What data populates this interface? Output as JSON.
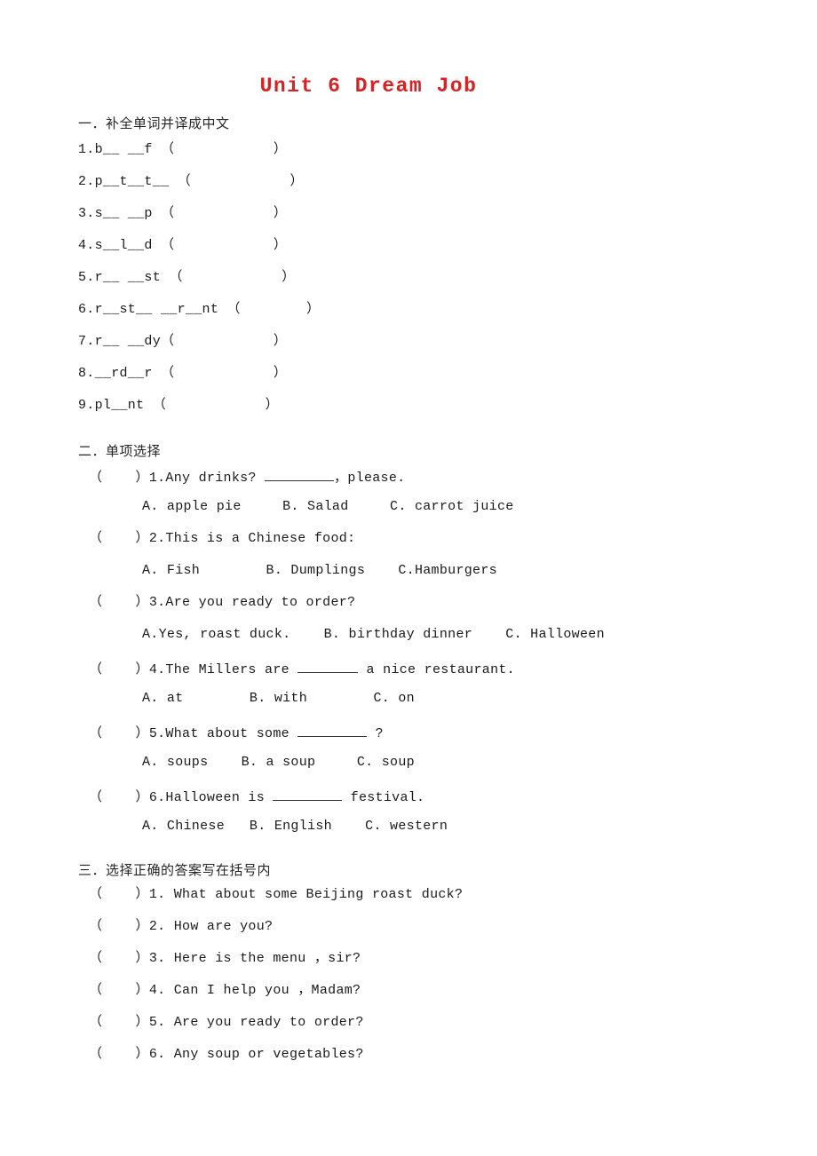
{
  "document": {
    "title": "Unit 6 Dream Job",
    "title_color": "#d62222"
  },
  "section1": {
    "heading": "一．补全单词并译成中文",
    "items": [
      {
        "number": "1.",
        "pre": "b",
        "blank1": "__",
        "mid": " ",
        "blank2": "__",
        "post": "f",
        "paren_open": "（",
        "paren_space": "            ",
        "paren_close": "）"
      },
      {
        "number": "2.",
        "text": "p__t__t__ （            ）"
      },
      {
        "number": "3.",
        "text": "s__ __p （            ）"
      },
      {
        "number": "4.",
        "text": "s__l__d （            ）"
      },
      {
        "number": "5.",
        "text": "r__ __st （            ）"
      },
      {
        "number": "6.",
        "text": "r__st__ __r__nt （        ）"
      },
      {
        "number": "7.",
        "text": "r__ __dy（            ）"
      },
      {
        "number": "8.",
        "text": "__rd__r （            ）"
      },
      {
        "number": "9.",
        "text": "pl__nt （            ）"
      }
    ],
    "raw_lines": [
      "1.b__ __f （            ）",
      "2.p__t__t__ （            ）",
      "3.s__ __p （            ）",
      "4.s__l__d （            ）",
      "5.r__ __st （            ）",
      "6.r__st__ __r__nt （        ）",
      "7.r__ __dy（            ）",
      "8.__rd__r （            ）",
      "9.pl__nt （            ）"
    ]
  },
  "section2": {
    "heading": "二．单项选择",
    "questions": [
      {
        "bracket": "（    ）",
        "number": "1.",
        "stem_before": "Any drinks? ",
        "stem_after": "，please.",
        "blank_size": "blank-lg",
        "options": "A. apple pie     B. Salad     C. carrot juice"
      },
      {
        "bracket": "（    ）",
        "number": "2.",
        "stem_before": "This is a Chinese food:",
        "stem_after": "",
        "blank_size": "none",
        "options": "A. Fish        B. Dumplings    C.Hamburgers"
      },
      {
        "bracket": "（    ）",
        "number": "3.",
        "stem_before": "Are you ready to order?",
        "stem_after": "",
        "blank_size": "none",
        "options": "A.Yes, roast duck.    B. birthday dinner    C. Halloween"
      },
      {
        "bracket": "（    ）",
        "number": "4.",
        "stem_before": "The Millers are ",
        "stem_after": " a nice restaurant.",
        "blank_size": "blank-md",
        "options": "A. at        B. with        C. on"
      },
      {
        "bracket": "（    ）",
        "number": "5.",
        "stem_before": "What about some ",
        "stem_after": " ?",
        "blank_size": "blank-lg",
        "options": "A. soups    B. a soup     C. soup"
      },
      {
        "bracket": "（    ）",
        "number": "6.",
        "stem_before": "Halloween is ",
        "stem_after": " festival.",
        "blank_size": "blank-lg",
        "options": "A. Chinese   B. English    C. western"
      }
    ]
  },
  "section3": {
    "heading": "三．选择正确的答案写在括号内",
    "items": [
      {
        "bracket": "（    ）",
        "number": "1.",
        "text": " What about some Beijing roast duck?"
      },
      {
        "bracket": "（    ）",
        "number": "2.",
        "text": " How are you?"
      },
      {
        "bracket": "（    ）",
        "number": "3.",
        "text": " Here is the menu ，sir?"
      },
      {
        "bracket": "（    ）",
        "number": "4.",
        "text": " Can I help you ，Madam?"
      },
      {
        "bracket": "（    ）",
        "number": "5.",
        "text": " Are you ready to order?"
      },
      {
        "bracket": "（    ）",
        "number": "6.",
        "text": " Any soup or vegetables?"
      }
    ]
  }
}
